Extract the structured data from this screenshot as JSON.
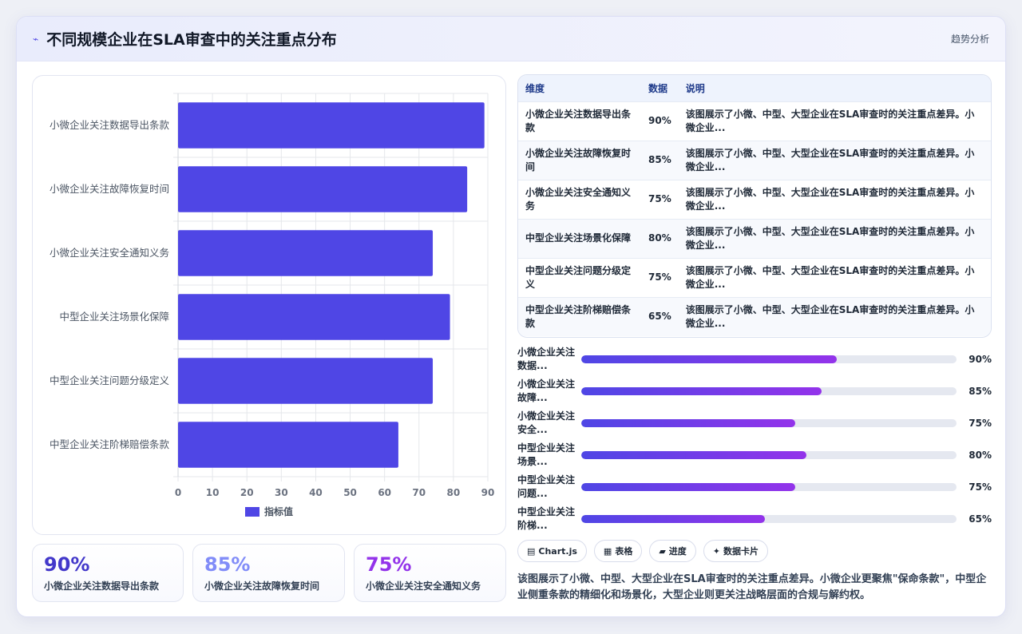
{
  "header": {
    "title": "不同规模企业在SLA审查中的关注重点分布",
    "right_link": "趋势分析",
    "icon": "trend-icon"
  },
  "chart_data": {
    "type": "bar",
    "orientation": "horizontal",
    "categories": [
      "小微企业关注数据导出条款",
      "小微企业关注故障恢复时间",
      "小微企业关注安全通知义务",
      "中型企业关注场景化保障",
      "中型企业关注问题分级定义",
      "中型企业关注阶梯赔偿条款"
    ],
    "series": [
      {
        "name": "指标值",
        "values": [
          89,
          84,
          74,
          79,
          74,
          64
        ]
      }
    ],
    "xlim": [
      0,
      90
    ],
    "xticks": [
      "0",
      "10",
      "20",
      "30",
      "40",
      "50",
      "60",
      "70",
      "80",
      "90"
    ],
    "grid": true,
    "legend": "bottom",
    "color": "#4f46e5"
  },
  "stats": [
    {
      "value": "90%",
      "label": "小微企业关注数据导出条款",
      "color": "#4338ca"
    },
    {
      "value": "85%",
      "label": "小微企业关注故障恢复时间",
      "color": "#818cf8"
    },
    {
      "value": "75%",
      "label": "小微企业关注安全通知义务",
      "color": "#9333ea"
    }
  ],
  "table": {
    "headers": [
      "维度",
      "数据",
      "说明"
    ],
    "rows": [
      {
        "dim": "小微企业关注数据导出条款",
        "val": "90%",
        "desc": "该图展示了小微、中型、大型企业在SLA审查时的关注重点差异。小微企业..."
      },
      {
        "dim": "小微企业关注故障恢复时间",
        "val": "85%",
        "desc": "该图展示了小微、中型、大型企业在SLA审查时的关注重点差异。小微企业..."
      },
      {
        "dim": "小微企业关注安全通知义务",
        "val": "75%",
        "desc": "该图展示了小微、中型、大型企业在SLA审查时的关注重点差异。小微企业..."
      },
      {
        "dim": "中型企业关注场景化保障",
        "val": "80%",
        "desc": "该图展示了小微、中型、大型企业在SLA审查时的关注重点差异。小微企业..."
      },
      {
        "dim": "中型企业关注问题分级定义",
        "val": "75%",
        "desc": "该图展示了小微、中型、大型企业在SLA审查时的关注重点差异。小微企业..."
      },
      {
        "dim": "中型企业关注阶梯赔偿条款",
        "val": "65%",
        "desc": "该图展示了小微、中型、大型企业在SLA审查时的关注重点差异。小微企业..."
      }
    ]
  },
  "progress": [
    {
      "label": "小微企业关注数据...",
      "percent": 68,
      "value": "90%"
    },
    {
      "label": "小微企业关注故障...",
      "percent": 64,
      "value": "85%"
    },
    {
      "label": "小微企业关注安全...",
      "percent": 57,
      "value": "75%"
    },
    {
      "label": "中型企业关注场景...",
      "percent": 60,
      "value": "80%"
    },
    {
      "label": "中型企业关注问题...",
      "percent": 57,
      "value": "75%"
    },
    {
      "label": "中型企业关注阶梯...",
      "percent": 49,
      "value": "65%"
    }
  ],
  "tags": [
    {
      "icon": "▤",
      "label": "Chart.js"
    },
    {
      "icon": "▦",
      "label": "表格"
    },
    {
      "icon": "▰",
      "label": "进度"
    },
    {
      "icon": "✦",
      "label": "数据卡片"
    }
  ],
  "description": "该图展示了小微、中型、大型企业在SLA审查时的关注重点差异。小微企业更聚焦\"保命条款\"，中型企业侧重条款的精细化和场景化，大型企业则更关注战略层面的合规与解约权。"
}
